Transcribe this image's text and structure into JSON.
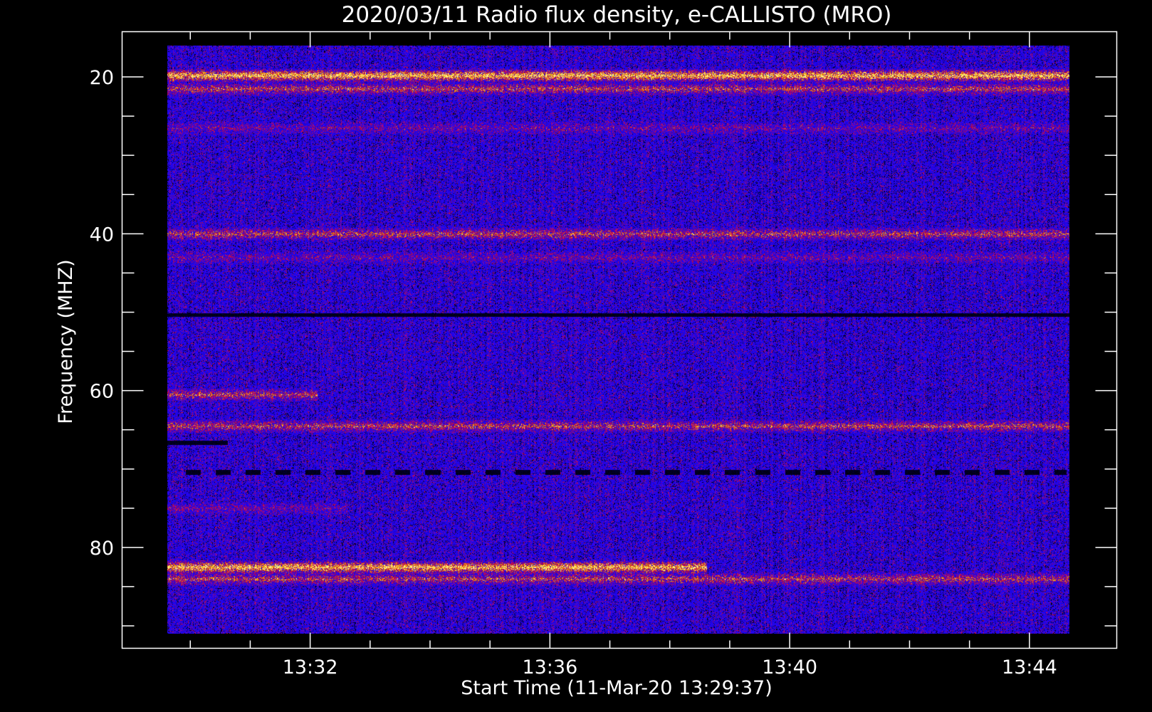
{
  "chart_data": {
    "type": "heatmap",
    "title": "2020/03/11  Radio flux density, e-CALLISTO (MRO)",
    "xlabel": "Start Time (11-Mar-20 13:29:37)",
    "ylabel": "Frequency (MHZ)",
    "x_start_time": "13:29:37",
    "xlim_minutes": [
      "13:29:37",
      "13:44:40"
    ],
    "ylim": [
      16,
      91
    ],
    "y_inverted": true,
    "x_ticks": [
      "13:32",
      "13:36",
      "13:40",
      "13:44"
    ],
    "x_tick_minutes": [
      2.383,
      6.383,
      10.383,
      14.383
    ],
    "y_ticks": [
      20,
      40,
      60,
      80
    ],
    "colormap": [
      "#000000",
      "#1400ff",
      "#3a00d0",
      "#c01818",
      "#ff7a00",
      "#ffff60"
    ],
    "background_color": "#1a10f0",
    "features": [
      {
        "type": "band",
        "freq": 19.8,
        "intensity": "strong",
        "t_from": 0.0,
        "t_to": 15.05
      },
      {
        "type": "band",
        "freq": 21.5,
        "intensity": "medium",
        "t_from": 0.0,
        "t_to": 15.05
      },
      {
        "type": "band",
        "freq": 26.5,
        "intensity": "weak",
        "t_from": 0.0,
        "t_to": 15.05
      },
      {
        "type": "band",
        "freq": 40.0,
        "intensity": "medium",
        "t_from": 0.0,
        "t_to": 15.05
      },
      {
        "type": "band",
        "freq": 43.0,
        "intensity": "weak",
        "t_from": 0.0,
        "t_to": 15.05
      },
      {
        "type": "dark_line",
        "freq": 50.3,
        "t_from": 0.0,
        "t_to": 15.05
      },
      {
        "type": "band",
        "freq": 60.5,
        "intensity": "medium",
        "t_from": 0.0,
        "t_to": 2.5
      },
      {
        "type": "band",
        "freq": 64.5,
        "intensity": "medium",
        "t_from": 0.0,
        "t_to": 15.05
      },
      {
        "type": "dark_line",
        "freq": 66.6,
        "t_from": 0.0,
        "t_to": 1.0
      },
      {
        "type": "dashed_dark_line",
        "freq": 70.4,
        "t_from": 0.3,
        "t_to": 15.0
      },
      {
        "type": "band",
        "freq": 75.0,
        "intensity": "weak",
        "t_from": 0.0,
        "t_to": 3.0
      },
      {
        "type": "band",
        "freq": 82.5,
        "intensity": "strong",
        "t_from": 0.0,
        "t_to": 9.0
      },
      {
        "type": "band",
        "freq": 84.0,
        "intensity": "medium",
        "t_from": 0.0,
        "t_to": 15.05
      }
    ]
  }
}
